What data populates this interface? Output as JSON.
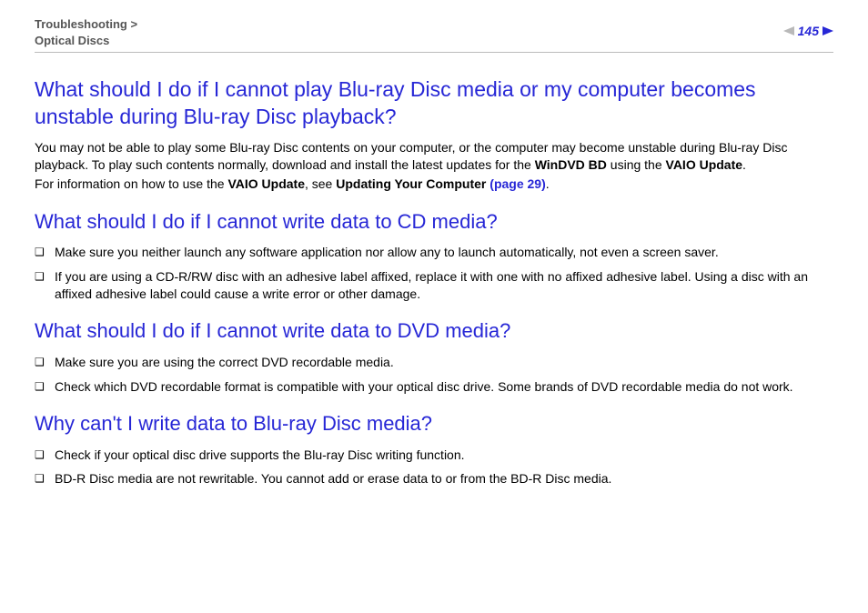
{
  "header": {
    "breadcrumb_section": "Troubleshooting",
    "breadcrumb_sep": " > ",
    "breadcrumb_sub": "Optical Discs",
    "page_number": "145"
  },
  "sections": {
    "q1": {
      "title": "What should I do if I cannot play Blu-ray Disc media or my computer becomes unstable during Blu-ray Disc playback?",
      "para_a": "You may not be able to play some Blu-ray Disc contents on your computer, or the computer may become unstable during Blu-ray Disc playback. To play such contents normally, download and install the latest updates for the ",
      "para_a_bold1": "WinDVD BD",
      "para_a_mid": " using the ",
      "para_a_bold2": "VAIO Update",
      "para_a_end": ".",
      "para_b_lead": "For information on how to use the ",
      "para_b_bold": "VAIO Update",
      "para_b_mid": ", see ",
      "para_b_bold2": "Updating Your Computer ",
      "para_b_link": "(page 29)",
      "para_b_end": "."
    },
    "q2": {
      "title": "What should I do if I cannot write data to CD media?",
      "bullets": [
        "Make sure you neither launch any software application nor allow any to launch automatically, not even a screen saver.",
        "If you are using a CD-R/RW disc with an adhesive label affixed, replace it with one with no affixed adhesive label. Using a disc with an affixed adhesive label could cause a write error or other damage."
      ]
    },
    "q3": {
      "title": "What should I do if I cannot write data to DVD media?",
      "bullets": [
        "Make sure you are using the correct DVD recordable media.",
        "Check which DVD recordable format is compatible with your optical disc drive. Some brands of DVD recordable media do not work."
      ]
    },
    "q4": {
      "title": "Why can't I write data to Blu-ray Disc media?",
      "bullets": [
        "Check if your optical disc drive supports the Blu-ray Disc writing function.",
        "BD-R Disc media are not rewritable. You cannot add or erase data to or from the BD-R Disc media."
      ]
    }
  }
}
